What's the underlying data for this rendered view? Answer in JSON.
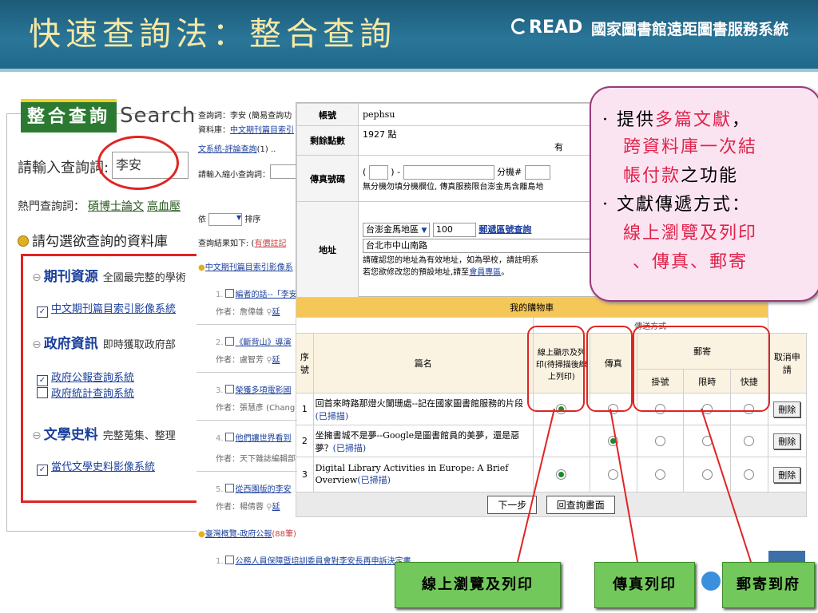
{
  "header": {
    "title": "快速查詢法：整合查詢",
    "logo": "READ",
    "system_name": "國家圖書館遠距圖書服務系統"
  },
  "left": {
    "tab": "整合查詢",
    "tab_en": "Search",
    "query_label": "請輸入查詢詞:",
    "query_value": "李安",
    "hot_label": "熱門查詢詞：",
    "hot_items": [
      "碩博士論文",
      "高血壓"
    ],
    "choose_label": "請勾選欲查詢的資料庫",
    "categories": [
      {
        "name": "期刊資源",
        "desc": "全國最完整的學術"
      },
      {
        "name": "政府資訊",
        "desc": "即時獲取政府部"
      },
      {
        "name": "文學史料",
        "desc": "完整蒐集、整理"
      }
    ],
    "databases": {
      "periodical": "中文期刊篇目索引影像系統",
      "gov_bulletin": "政府公報查詢系統",
      "gov_stats": "政府統計查詢系統",
      "literature": "當代文學史料影像系統"
    }
  },
  "middle": {
    "line1": "查詢詞：李安 (簡易查詢功",
    "line2_label": "資料庫：",
    "line2_link": "中文期刊篇目索引",
    "line3_link": "文系統-評論查詢",
    "line3_tail": "(1) ..",
    "narrow": "請輸入縮小查詢詞：",
    "sort_tail": "依",
    "sort_label": "排序",
    "results_label": "查詢結果如下: (",
    "results_link": "有價註記",
    "db_link": "中文期刊篇目索引影像系",
    "items": [
      {
        "num": "1.",
        "title": "編者的話--「李安",
        "author": "作者：詹偉雄",
        "mark": "延"
      },
      {
        "num": "2.",
        "title": "《斷背山》導演",
        "author": "作者：盧智芳",
        "mark": "延"
      },
      {
        "num": "3.",
        "title": "榮獲多項電影國",
        "author": "作者：張慧彥 (Chang",
        "mark": ""
      },
      {
        "num": "4.",
        "title": "他們讓世界看到",
        "author": "作者：天下雜誌編輯部",
        "mark": ""
      },
      {
        "num": "5.",
        "title": "從西園版的李安",
        "author": "作者：楊倩蓉",
        "mark": "延"
      }
    ],
    "gov_link": "臺灣概覽-政府公報",
    "gov_count": "(88筆)",
    "gov_item": "公務人員保障暨培訓委員會對李安長再申訴決定書"
  },
  "form": {
    "account_label": "帳號",
    "account_value": "pephsu",
    "points_label": "剩餘點數",
    "points_value": "1927 點",
    "points_tail": "有",
    "fax_label": "傳真號碼",
    "fax_prefix": "(",
    "fax_mid": ") -",
    "fax_ext": "分機#",
    "fax_note": "無分機勿填分機欄位, 傳真服務限台澎金馬含離島地",
    "addr_label": "地址",
    "region": "台澎金馬地區",
    "zip": "100",
    "zip_link": "郵遞區號查詢",
    "address": "台北市中山南路",
    "addr_note1": "請確認您的地址為有效地址，如為學校，請註明系",
    "addr_note2": "若您欲修改您的預設地址,請至",
    "member_link": "會員專區",
    "addr_note2_tail": "。"
  },
  "cart": {
    "title": "我的購物車",
    "delivery_label": "傳送方式",
    "col_seq": "序號",
    "col_title": "篇名",
    "col_online": "線上顯示及列印(待掃描後線上列印)",
    "col_fax": "傳真",
    "col_mail": "郵寄",
    "col_registered": "掛號",
    "col_express": "限時",
    "col_quick": "快捷",
    "col_cancel": "取消申請",
    "rows": [
      {
        "seq": "1",
        "title": "回首來時路那燈火闌珊處--記在國家圖書館服務的片段",
        "scan": "(已掃描)",
        "selected": "online"
      },
      {
        "seq": "2",
        "title": "坐擁書城不是夢--Google是圖書館員的美夢，還是惡夢？",
        "scan": "(已掃描)",
        "selected": "fax"
      },
      {
        "seq": "3",
        "title": "Digital Library Activities in Europe: A Brief Overview",
        "scan": "(已掃描)",
        "selected": "online"
      }
    ],
    "delete_label": "刪除",
    "next_label": "下一步",
    "back_label": "回查詢畫面"
  },
  "callout": {
    "line1_prefix": "提供",
    "line1_red": "多篇文獻",
    "line1_suffix": "，",
    "line2_red": "跨資料庫一次結",
    "line3_red": "帳付款",
    "line3_suffix": "之功能",
    "line4": "文獻傳遞方式：",
    "line5_red": "線上瀏覽及列印",
    "line6_red": "、傳真、郵寄"
  },
  "labels": {
    "online": "線上瀏覽及列印",
    "fax": "傳真列印",
    "mail": "郵寄到府"
  },
  "colors": {
    "header": "#2a7699",
    "accent_red": "#e02424",
    "label_green": "#72c85a",
    "callout_bg": "#fbe4f2"
  }
}
